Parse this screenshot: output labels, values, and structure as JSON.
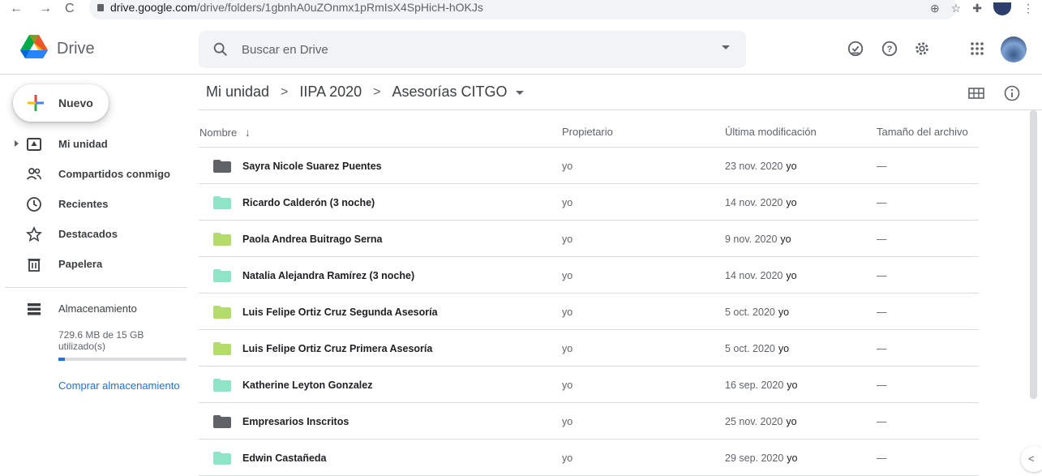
{
  "browser": {
    "back": "←",
    "forward": "→",
    "reload": "C",
    "url_host": "drive.google.com",
    "url_path": "/drive/folders/1gbnhA0uZOnmx1pRmIsX4SpHicH-hOKJs"
  },
  "header": {
    "brand": "Drive",
    "search_placeholder": "Buscar en Drive"
  },
  "sidebar": {
    "new_label": "Nuevo",
    "items": [
      {
        "label": "Mi unidad",
        "icon": "drive-icon"
      },
      {
        "label": "Compartidos conmigo",
        "icon": "people-icon"
      },
      {
        "label": "Recientes",
        "icon": "clock-icon"
      },
      {
        "label": "Destacados",
        "icon": "star-icon"
      },
      {
        "label": "Papelera",
        "icon": "trash-icon"
      }
    ],
    "storage_label": "Almacenamiento",
    "storage_text": "729.6 MB de 15 GB utilizado(s)",
    "storage_fraction": 0.049,
    "buy_label": "Comprar almacenamiento"
  },
  "breadcrumb": {
    "items": [
      "Mi unidad",
      "IIPA 2020",
      "Asesorías CITGO"
    ],
    "sep": ">"
  },
  "table": {
    "headers": {
      "name": "Nombre",
      "owner": "Propietario",
      "modified": "Última modificación",
      "size": "Tamaño del archivo"
    },
    "rows": [
      {
        "name": "Sayra Nicole Suarez Puentes",
        "owner": "yo",
        "date": "23 nov. 2020",
        "by": "yo",
        "size": "—",
        "color": "#5f6368"
      },
      {
        "name": "Ricardo Calderón (3 noche)",
        "owner": "yo",
        "date": "14 nov. 2020",
        "by": "yo",
        "size": "—",
        "color": "#8ee4c7"
      },
      {
        "name": "Paola Andrea Buitrago Serna",
        "owner": "yo",
        "date": "9 nov. 2020",
        "by": "yo",
        "size": "—",
        "color": "#b3dc6c"
      },
      {
        "name": "Natalia Alejandra Ramírez (3 noche)",
        "owner": "yo",
        "date": "14 nov. 2020",
        "by": "yo",
        "size": "—",
        "color": "#8ee4c7"
      },
      {
        "name": "Luis Felipe Ortiz Cruz Segunda Asesoría",
        "owner": "yo",
        "date": "5 oct. 2020",
        "by": "yo",
        "size": "—",
        "color": "#b3dc6c"
      },
      {
        "name": "Luis Felipe Ortiz Cruz Primera Asesoría",
        "owner": "yo",
        "date": "5 oct. 2020",
        "by": "yo",
        "size": "—",
        "color": "#b3dc6c"
      },
      {
        "name": "Katherine Leyton Gonzalez",
        "owner": "yo",
        "date": "16 sep. 2020",
        "by": "yo",
        "size": "—",
        "color": "#8ee4c7"
      },
      {
        "name": "Empresarios Inscritos",
        "owner": "yo",
        "date": "25 nov. 2020",
        "by": "yo",
        "size": "—",
        "color": "#5f6368"
      },
      {
        "name": "Edwin Castañeda",
        "owner": "yo",
        "date": "29 sep. 2020",
        "by": "yo",
        "size": "—",
        "color": "#8ee4c7"
      }
    ]
  }
}
